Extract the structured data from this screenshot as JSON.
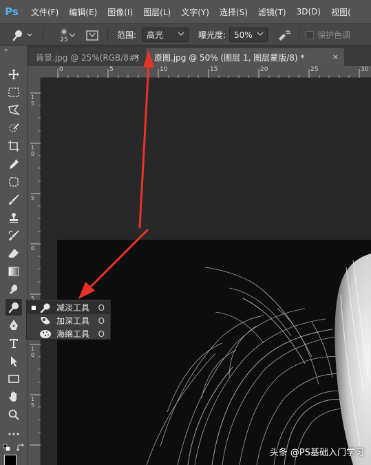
{
  "app": {
    "logo": "Ps"
  },
  "menu": {
    "items": [
      "文件(F)",
      "编辑(E)",
      "图像(I)",
      "图层(L)",
      "文字(Y)",
      "选择(S)",
      "滤镜(T)",
      "3D(D)",
      "视图("
    ]
  },
  "options": {
    "brush_size": "25",
    "range_label": "范围:",
    "range_value": "高光",
    "exposure_label": "曝光度:",
    "exposure_value": "50%",
    "protect_tones_label": "保护色调"
  },
  "tabs": [
    {
      "label": "背景.jpg @ 25%(RGB/8#)",
      "close": "×"
    },
    {
      "label": "原图.jpg @ 50% (图层 1, 图层蒙版/8) *",
      "close": "×"
    }
  ],
  "ruler_top_labels": [
    "0",
    "5",
    "10",
    "15",
    "20",
    "25",
    "30"
  ],
  "ruler_left_labels": [
    "1\n5",
    "1\n0",
    "5",
    "0",
    "5",
    "1\n0",
    "1\n5"
  ],
  "tool_flyout": {
    "items": [
      {
        "label": "减淡工具",
        "shortcut": "O",
        "selected": true,
        "bullet": "■"
      },
      {
        "label": "加深工具",
        "shortcut": "O",
        "selected": false,
        "bullet": ""
      },
      {
        "label": "海绵工具",
        "shortcut": "O",
        "selected": false,
        "bullet": ""
      }
    ]
  },
  "tools": [
    "move-tool",
    "marquee-tool",
    "lasso-tool",
    "quick-select-tool",
    "crop-tool",
    "eyedropper-tool",
    "patch-tool",
    "brush-tool",
    "clone-stamp-tool",
    "history-brush-tool",
    "eraser-tool",
    "gradient-tool",
    "smudge-tool",
    "dodge-tool",
    "pen-tool",
    "type-tool",
    "path-select-tool",
    "rectangle-tool",
    "hand-tool",
    "zoom-tool",
    "more-tools"
  ],
  "watermark": "头条 @PS基础入门学习",
  "colors": {
    "menubar": "#535353",
    "optionsbar": "#474747",
    "arrow": "#e8332a",
    "logo": "#4fb1f5"
  }
}
